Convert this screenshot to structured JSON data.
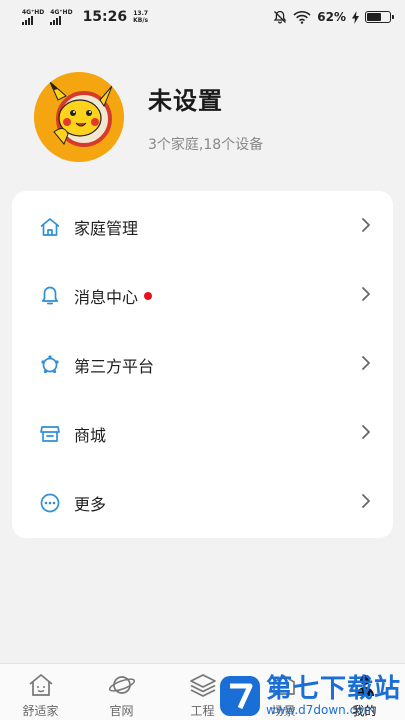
{
  "status_bar": {
    "network_1": "4G⁺HD",
    "network_2": "4G⁺HD",
    "time": "15:26",
    "speed_value": "13.7",
    "speed_unit": "KB/s",
    "battery": "62%"
  },
  "profile": {
    "username": "未设置",
    "subtitle": "3个家庭,18个设备"
  },
  "menu": {
    "items": [
      {
        "label": "家庭管理",
        "icon": "home-icon"
      },
      {
        "label": "消息中心",
        "icon": "bell-icon",
        "badge_color": "#e8101c"
      },
      {
        "label": "第三方平台",
        "icon": "third-party-platform-icon"
      },
      {
        "label": "商城",
        "icon": "store-icon"
      },
      {
        "label": "更多",
        "icon": "more-icon"
      }
    ]
  },
  "tabs": [
    {
      "label": "舒适家",
      "icon": "comfort-home-icon"
    },
    {
      "label": "官网",
      "icon": "planet-icon"
    },
    {
      "label": "工程",
      "icon": "layers-icon"
    },
    {
      "label": "场景",
      "icon": "scene-icon"
    },
    {
      "label": "我的",
      "icon": "profile-icon",
      "active": true
    }
  ],
  "watermark": {
    "title": "第七下载站",
    "url": "www.d7down.com"
  },
  "colors": {
    "accent_blue": "#2f8fd8",
    "avatar_bg": "#f5a50f",
    "badge_red": "#e8101c",
    "watermark_blue": "#1a6fd6"
  }
}
